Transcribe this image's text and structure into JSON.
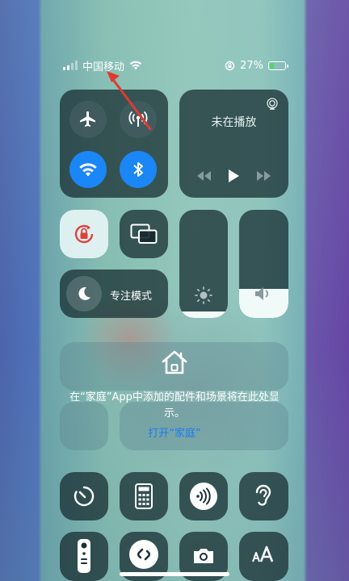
{
  "status_bar": {
    "carrier": "中国移动",
    "battery_percent": "27%",
    "battery_level": 0.27
  },
  "media": {
    "title": "未在播放"
  },
  "focus": {
    "label": "专注模式"
  },
  "sliders": {
    "brightness_level": 0.06,
    "volume_level": 0.27
  },
  "home": {
    "message": "在“家庭”App中添加的配件和场景将在此处显示。",
    "link": "打开“家庭”"
  },
  "colors": {
    "accent_blue": "#1b86f5",
    "link_blue": "#1b7cf0",
    "battery_green": "#4cd964",
    "annotation_red": "#e03a30"
  }
}
